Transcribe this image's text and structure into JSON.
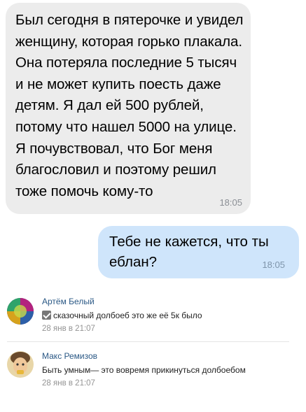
{
  "messages": [
    {
      "text": "Был сегодня в пятерочке и увидел женщину, которая горько плакала. Она потеряла последние 5 тысяч и не может купить поесть даже детям. Я дал ей 500 рублей, потому что нашел 5000 на улице. Я почувствовал, что Бог меня благословил и поэтому решил тоже помочь кому-то",
      "time": "18:05"
    },
    {
      "text": "Тебе не кажется, что ты еблан?",
      "time": "18:05"
    }
  ],
  "comments": [
    {
      "author": "Артём Белый",
      "text": "сказочный долбоеб это же её 5к было",
      "has_check_emoji": true,
      "date": "28 янв в 21:07",
      "avatar": "avatar-colorful-icon"
    },
    {
      "author": "Макс Ремизов",
      "text": "Быть умным— это вовремя прикинуться долбоебом",
      "date": "28 янв в 21:07",
      "avatar": "avatar-face-icon"
    }
  ],
  "colors": {
    "incoming_bubble": "#ececec",
    "outgoing_bubble": "#cfe5fb",
    "author_link": "#2a5885"
  }
}
